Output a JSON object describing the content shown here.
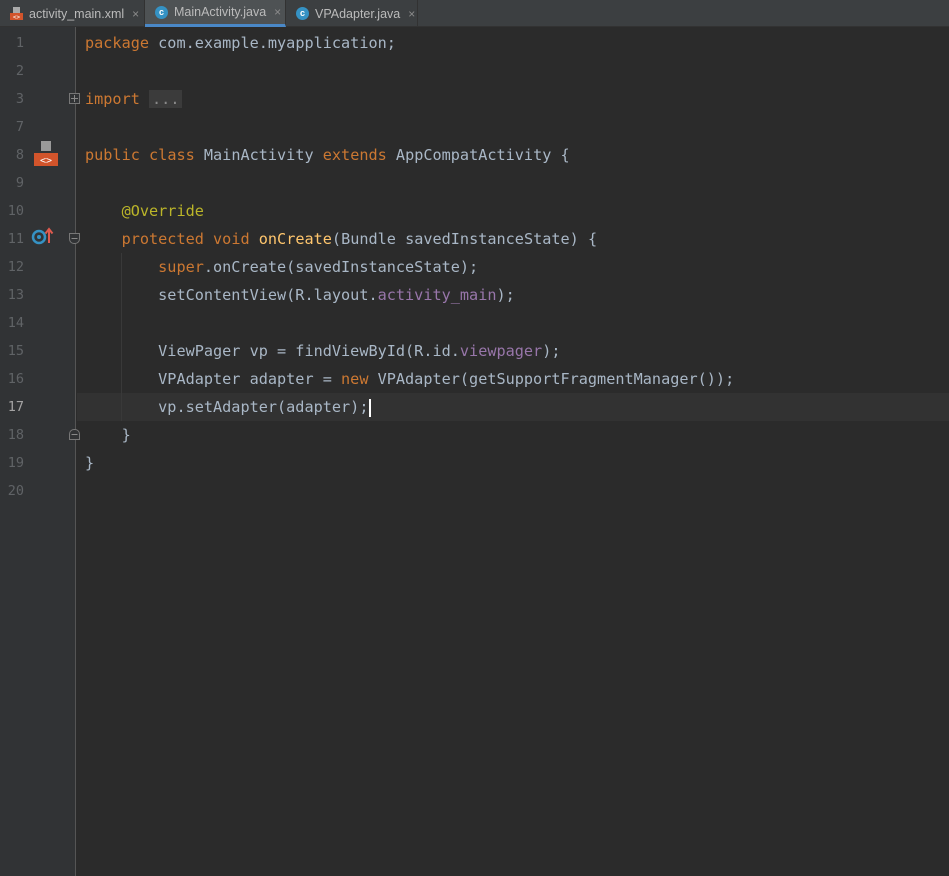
{
  "tabs": [
    {
      "label": "activity_main.xml",
      "icon": "xml-file-icon",
      "active": false
    },
    {
      "label": "MainActivity.java",
      "icon": "java-class-icon",
      "active": true
    },
    {
      "label": "VPAdapter.java",
      "icon": "java-class-icon",
      "active": false
    }
  ],
  "tab_close": "×",
  "line_numbers": [
    "1",
    "2",
    "3",
    "7",
    "8",
    "9",
    "10",
    "11",
    "12",
    "13",
    "14",
    "15",
    "16",
    "17",
    "18",
    "19",
    "20"
  ],
  "current_line": "17",
  "code": {
    "l1": {
      "kw": "package",
      "rest": " com.example.myapplication;"
    },
    "l3": {
      "kw": "import",
      "folded": "..."
    },
    "l8": {
      "kw1": "public",
      "kw2": "class",
      "name": " MainActivity ",
      "kw3": "extends",
      "rest": " AppCompatActivity {"
    },
    "l10": {
      "ann": "@Override"
    },
    "l11": {
      "kw1": "protected",
      "kw2": "void",
      "fn": "onCreate",
      "rest": "(Bundle savedInstanceState) {"
    },
    "l12": {
      "kw": "super",
      "rest": ".onCreate(savedInstanceState);"
    },
    "l13": {
      "pre": "setContentView(R.layout.",
      "field": "activity_main",
      "post": ");"
    },
    "l15": {
      "pre": "ViewPager vp = findViewById(R.id.",
      "field": "viewpager",
      "post": ");"
    },
    "l16": {
      "pre": "VPAdapter adapter = ",
      "kw": "new",
      "post": " VPAdapter(getSupportFragmentManager());"
    },
    "l17": {
      "text": "vp.setAdapter(adapter);"
    },
    "l18": {
      "text": "}"
    },
    "l19": {
      "text": "}"
    }
  },
  "colors": {
    "keyword": "#cc7832",
    "annotation": "#bbb529",
    "method": "#ffc66d",
    "field": "#9876aa",
    "text": "#a9b7c6",
    "background": "#2b2b2b"
  }
}
